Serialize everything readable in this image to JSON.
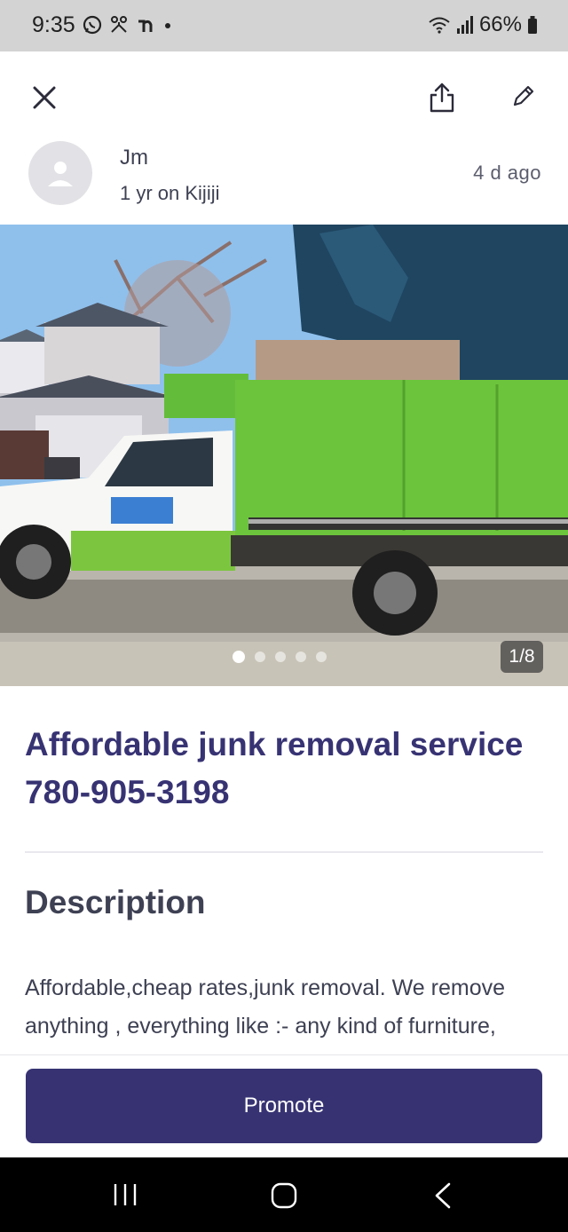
{
  "status_bar": {
    "time": "9:35",
    "battery": "66%",
    "icons": [
      "whatsapp-icon",
      "network-icon",
      "app-icon",
      "notification-dot-icon",
      "wifi-icon",
      "signal-icon",
      "battery-icon"
    ]
  },
  "toolbar": {
    "close_icon": "close-icon",
    "share_icon": "share-icon",
    "edit_icon": "edit-icon"
  },
  "seller": {
    "name": "Jm",
    "tenure": "1 yr on Kijiji",
    "posted": "4 d  ago",
    "avatar_icon": "user-icon"
  },
  "gallery": {
    "counter": "1/8",
    "current_page": 1,
    "total_pages": 8,
    "visible_dots": 5
  },
  "listing": {
    "title": "Affordable junk removal service 780-905-3198",
    "description_heading": "Description",
    "description_text": "Affordable,cheap rates,junk removal. We remove anything , everything like :- any kind of furniture, appliances, yard and bin"
  },
  "actions": {
    "promote_label": "Promote"
  },
  "colors": {
    "brand": "#373373",
    "text": "#3e4153",
    "truck_green": "#6cc43c"
  }
}
